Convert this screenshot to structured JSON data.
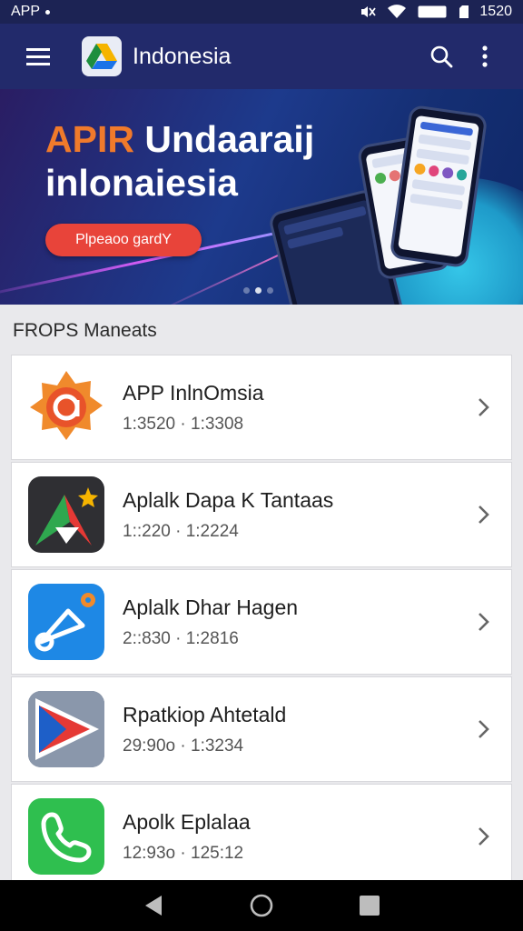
{
  "status_bar": {
    "carrier": "APP",
    "time": "1520"
  },
  "app_bar": {
    "title": "Indonesia"
  },
  "banner": {
    "headline_accent": "APIR",
    "headline_rest": "Undaaraij",
    "headline_line2": "inlonaiesia",
    "cta_label": "Plpeaoo gardY",
    "slides": 3,
    "active_slide": 2
  },
  "section": {
    "title": "FROPS Maneats"
  },
  "apps": [
    {
      "name": "APP InlnOmsia",
      "sub": "1:3520 · 1:3308",
      "icon": "orange-badge-icon",
      "color": "#e8532a"
    },
    {
      "name": "Aplalk Dapa K Tantaas",
      "sub": "1::220 · 1:2224",
      "icon": "kite-arrow-icon",
      "color": "#2f2f33"
    },
    {
      "name": "Aplalk Dhar Hagen",
      "sub": "2::830 · 1:2816",
      "icon": "cone-gear-icon",
      "color": "#1e88e5"
    },
    {
      "name": "Rpatkiop Ahtetald",
      "sub": "29:90o · 1:3234",
      "icon": "play-triangle-icon",
      "color": "#6f7b8c"
    },
    {
      "name": "Apolk Eplalaa",
      "sub": "12:93o · 125:12",
      "icon": "phone-call-icon",
      "color": "#2fbf4f"
    }
  ],
  "colors": {
    "status_bar": "#1c2354",
    "app_bar": "#222a6b",
    "cta": "#e8443a",
    "accent_text": "#f07a2b"
  }
}
